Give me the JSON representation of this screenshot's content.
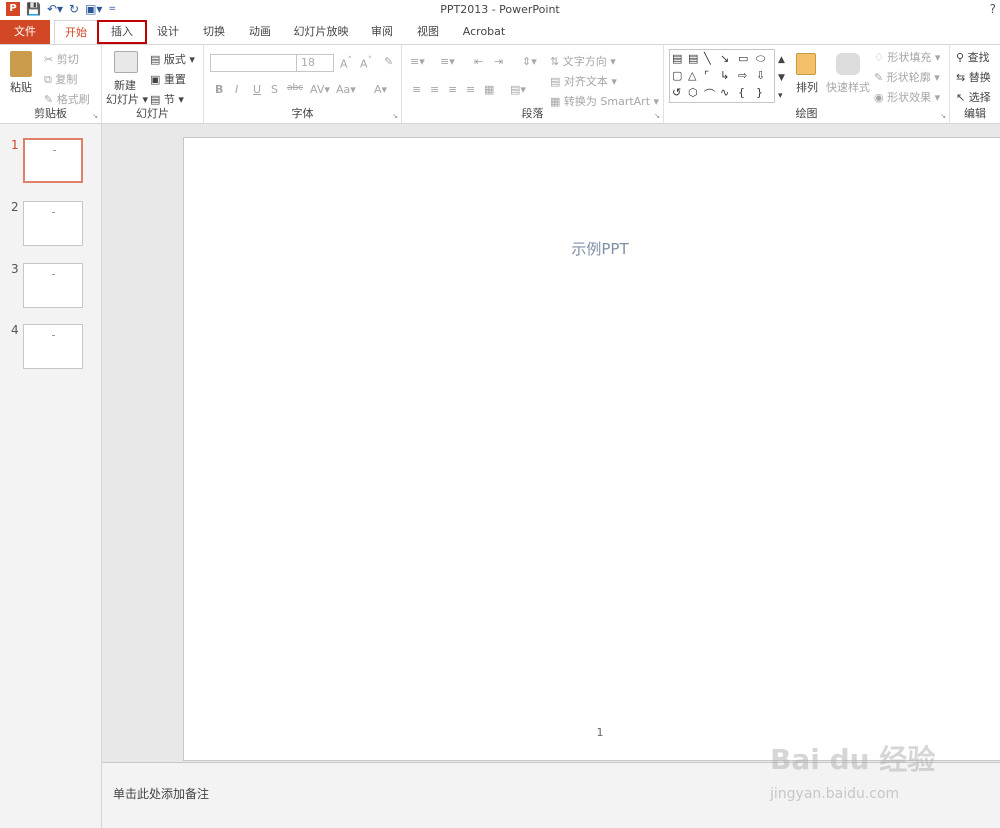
{
  "window": {
    "title": "PPT2013 - PowerPoint",
    "help": "?"
  },
  "qat": {
    "logo": "P",
    "save_icon": "save-icon",
    "undo_icon": "undo-icon",
    "redo_icon": "redo-icon",
    "present_icon": "slideshow-icon",
    "more": "="
  },
  "tabs": [
    {
      "label": "文件"
    },
    {
      "label": "开始"
    },
    {
      "label": "插入"
    },
    {
      "label": "设计"
    },
    {
      "label": "切换"
    },
    {
      "label": "动画"
    },
    {
      "label": "幻灯片放映"
    },
    {
      "label": "审阅"
    },
    {
      "label": "视图"
    },
    {
      "label": "Acrobat"
    }
  ],
  "ribbon": {
    "clipboard": {
      "label": "剪贴板",
      "paste": "粘贴",
      "cut": "剪切",
      "copy": "复制",
      "format_painter": "格式刷"
    },
    "slides": {
      "label": "幻灯片",
      "new_slide_1": "新建",
      "new_slide_2": "幻灯片",
      "layout": "版式",
      "reset": "重置",
      "section": "节"
    },
    "font": {
      "label": "字体",
      "font_name": "",
      "font_size": "18",
      "bold": "B",
      "italic": "I",
      "underline": "U",
      "shadow": "S",
      "strike": "abc",
      "spacing": "AV",
      "case": "Aa",
      "color": "A",
      "grow": "A",
      "shrink": "A"
    },
    "paragraph": {
      "label": "段落",
      "text_direction": "文字方向",
      "align_text": "对齐文本",
      "smartart": "转换为 SmartArt"
    },
    "drawing": {
      "label": "绘图",
      "arrange": "排列",
      "quick_styles": "快速样式",
      "shape_fill": "形状填充",
      "shape_outline": "形状轮廓",
      "shape_effects": "形状效果"
    },
    "editing": {
      "label": "编辑",
      "find": "查找",
      "replace": "替换",
      "select": "选择"
    }
  },
  "thumbnails": [
    {
      "num": "1"
    },
    {
      "num": "2"
    },
    {
      "num": "3"
    },
    {
      "num": "4"
    }
  ],
  "slide": {
    "title": "示例PPT",
    "page_number": "1"
  },
  "notes": {
    "placeholder": "单击此处添加备注"
  },
  "watermark": {
    "brand": "Bai du 经验",
    "url": "jingyan.baidu.com"
  },
  "colors": {
    "accent": "#d24726",
    "highlight_box": "#c00000"
  }
}
